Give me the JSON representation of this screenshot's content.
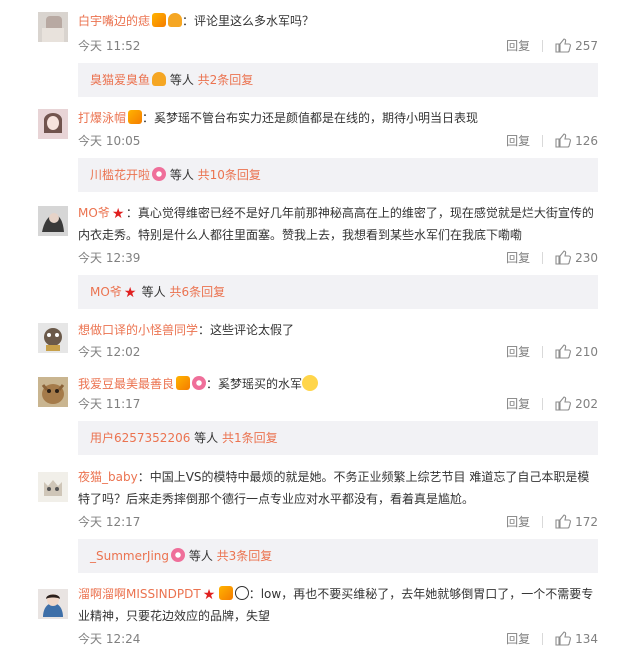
{
  "comments": [
    {
      "user": "白宇嘴边的痣",
      "badges": [
        "vip",
        "bulb"
      ],
      "text": "：评论里这么多水军吗？",
      "time": "今天 11:52",
      "reply": "回复",
      "likes": "257",
      "sub": {
        "user": "臭猫爱臭鱼",
        "suffix": " 等人 ",
        "more": "共2条回复"
      }
    },
    {
      "user": "打爆泳帽",
      "badges": [
        "vip"
      ],
      "text": "：奚梦瑶不管台布实力还是颜值都是在线的，期待小明当日表现",
      "time": "今天 10:05",
      "reply": "回复",
      "likes": "126",
      "sub": {
        "user": "川槛花开啦",
        "suffix": " 等人 ",
        "more": "共10条回复"
      }
    },
    {
      "user": "MO爷",
      "badges": [
        "star"
      ],
      "text_line1": "：真心觉得维密已经不是好几年前那神秘高高在上的维密了，现在感觉就是烂大街宣传的",
      "text_line2": "内衣走秀。特别是什么人都往里面塞。赞我上去，我想看到某些水军们在我底下嘞嘞",
      "time": "今天 12:39",
      "reply": "回复",
      "likes": "230",
      "sub": {
        "user": "MO爷",
        "suffix": " 等人 ",
        "more": "共6条回复"
      }
    },
    {
      "user": "想做口译的小怪兽同学",
      "badges": [],
      "text": "：这些评论太假了",
      "time": "今天 12:02",
      "reply": "回复",
      "likes": "210"
    },
    {
      "user": "我爱豆最美最善良",
      "badges": [
        "vip",
        "donut"
      ],
      "text": "：奚梦瑶买的水军",
      "time": "今天 11:17",
      "reply": "回复",
      "likes": "202",
      "sub": {
        "user": "用户6257352206",
        "suffix": " 等人 ",
        "more": "共1条回复"
      }
    },
    {
      "user": "夜猫_baby",
      "badges": [],
      "text_line1": "：中国上VS的模特中最烦的就是她。不务正业频繁上综艺节目 难道忘了自己本职是模",
      "text_line2": "特了吗？后来走秀摔倒那个德行一点专业应对水平都没有，看着真是尴尬。",
      "time": "今天 12:17",
      "reply": "回复",
      "likes": "172",
      "sub": {
        "user": "_SummerJing",
        "suffix": " 等人 ",
        "more": "共3条回复"
      }
    },
    {
      "user": "溜啊溜啊MISSINDPDT",
      "badges": [
        "star",
        "vip",
        "panda"
      ],
      "text_line1": "：low，再也不要买维秘了，去年她就够倒胃口了，一个不需要专",
      "text_line2": "业精神，只要花边效应的品牌，失望",
      "time": "今天 12:24",
      "reply": "回复",
      "likes": "134"
    }
  ],
  "colors": {
    "link": "#eb7350",
    "text": "#333333",
    "meta": "#808080",
    "sub_bg": "#f2f2f5"
  }
}
